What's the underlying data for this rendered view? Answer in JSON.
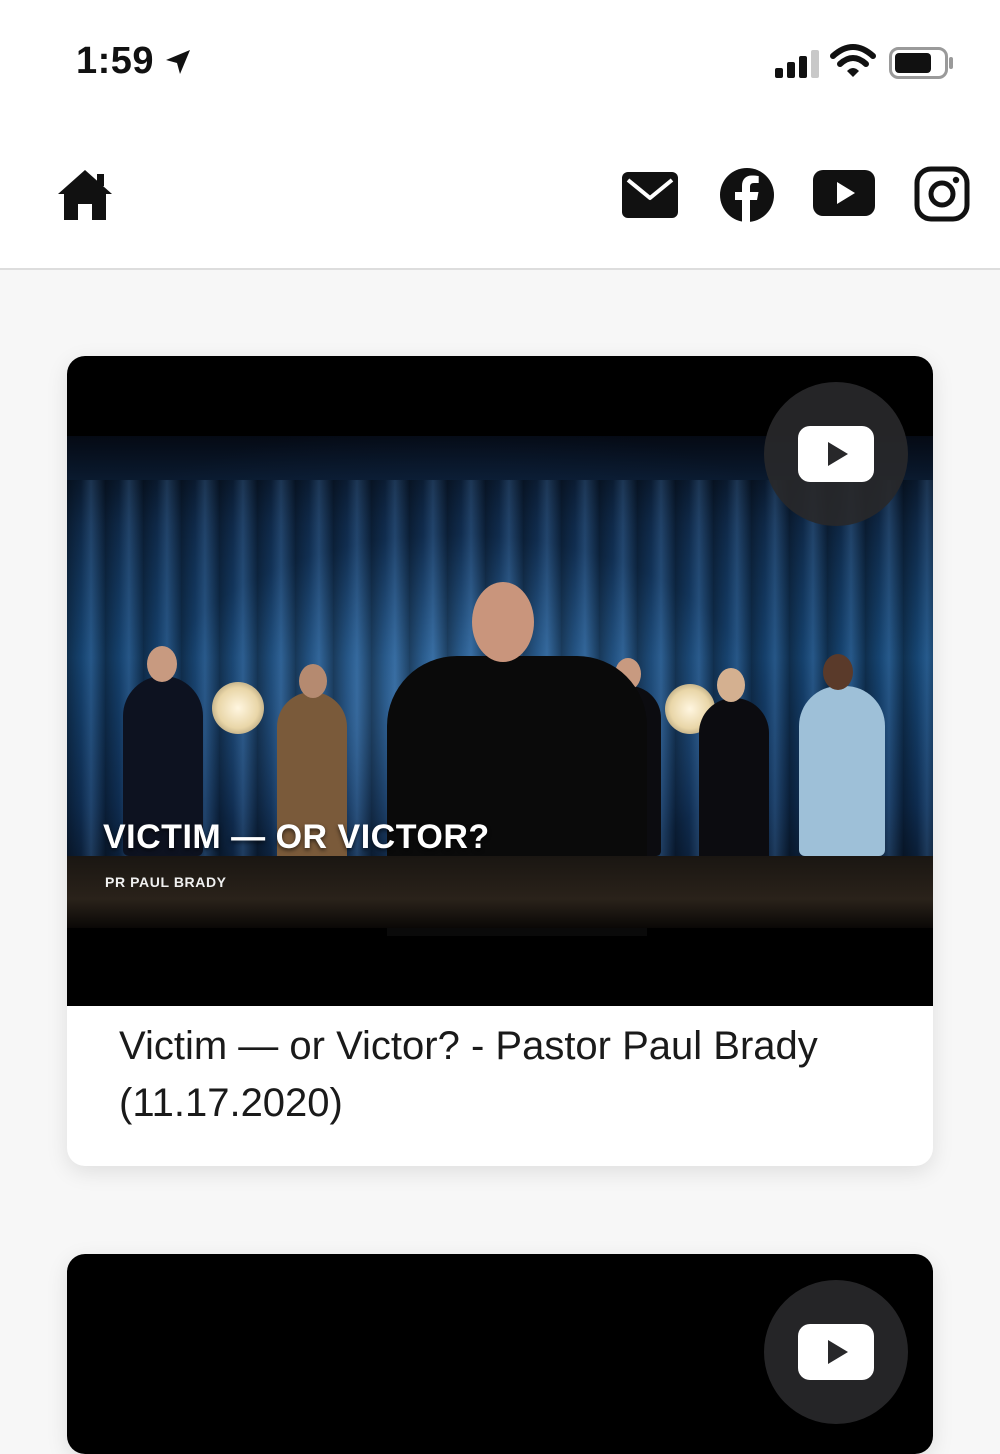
{
  "status_bar": {
    "time": "1:59"
  },
  "nav": {
    "icons": [
      "home-icon",
      "mail-icon",
      "facebook-icon",
      "youtube-icon",
      "instagram-icon"
    ]
  },
  "videos": [
    {
      "thumbnail_title": "VICTIM — OR VICTOR?",
      "thumbnail_subtitle": "PR PAUL BRADY",
      "caption": "Victim — or Victor? - Pastor Paul Brady (11.17.2020)"
    }
  ],
  "colors": {
    "youtube_badge": "#28282a",
    "nav_icon": "#111111"
  }
}
